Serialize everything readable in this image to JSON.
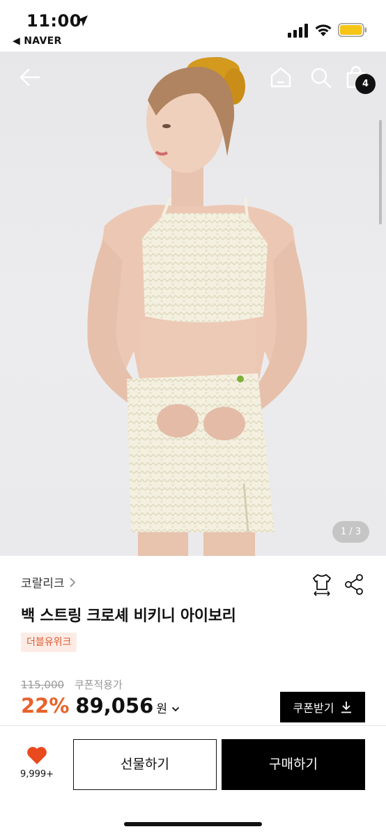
{
  "status_bar": {
    "time": "11:00",
    "back_app": "◀ NAVER",
    "battery_color": "#f5c518"
  },
  "hero": {
    "pager": "1 / 3",
    "cart_count": "4",
    "icons": [
      "back-arrow-icon",
      "home-icon",
      "search-icon",
      "shopping-bag-icon"
    ]
  },
  "product": {
    "brand": "코랄리크",
    "title": "백 스트링 크로셰 비키니 아이보리",
    "tag": "더블유위크",
    "original_price": "115,000",
    "coupon_label": "쿠폰적용가",
    "discount": "22%",
    "price": "89,056",
    "currency": "원",
    "coupon_button": "쿠폰받기",
    "accent_color": "#e8622b"
  },
  "bottom_bar": {
    "like_count": "9,999+",
    "gift_button": "선물하기",
    "buy_button": "구매하기",
    "heart_color": "#e8491d"
  }
}
